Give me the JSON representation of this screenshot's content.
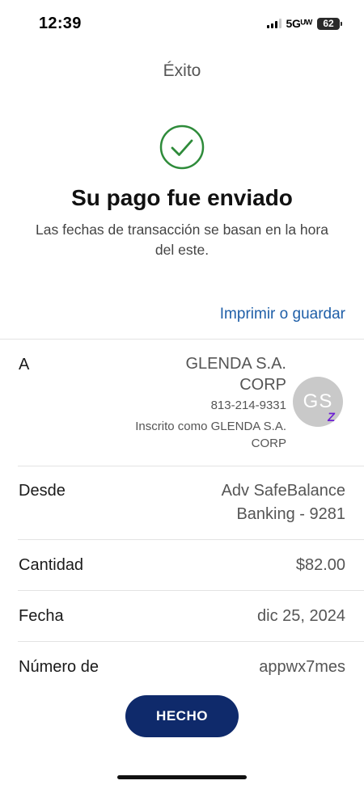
{
  "status_bar": {
    "time": "12:39",
    "network": "5Gᵁᵂ",
    "battery": "62"
  },
  "header": {
    "title": "Éxito"
  },
  "confirmation": {
    "title": "Su pago fue enviado",
    "subtitle": "Las fechas de transacción se basan en la hora del este.",
    "print_link": "Imprimir o guardar"
  },
  "details": {
    "to": {
      "label": "A",
      "name": "GLENDA S.A. CORP",
      "phone": "813-214-9331",
      "enrolled_as": "Inscrito como GLENDA S.A. CORP",
      "avatar_initials": "GS",
      "badge": "Z"
    },
    "from": {
      "label": "Desde",
      "value": "Adv SafeBalance Banking - 9281"
    },
    "amount": {
      "label": "Cantidad",
      "value": "$82.00"
    },
    "date": {
      "label": "Fecha",
      "value": "dic 25, 2024"
    },
    "confirmation_number": {
      "label": "Número de",
      "value": "appwx7mes"
    }
  },
  "actions": {
    "done_label": "HECHO"
  },
  "colors": {
    "accent_link": "#1f5fa8",
    "success_green": "#2e8b3a",
    "primary_button": "#0f2a6b",
    "zelle_purple": "#6d1ed4"
  },
  "icons": {
    "success": "check-circle-icon"
  }
}
